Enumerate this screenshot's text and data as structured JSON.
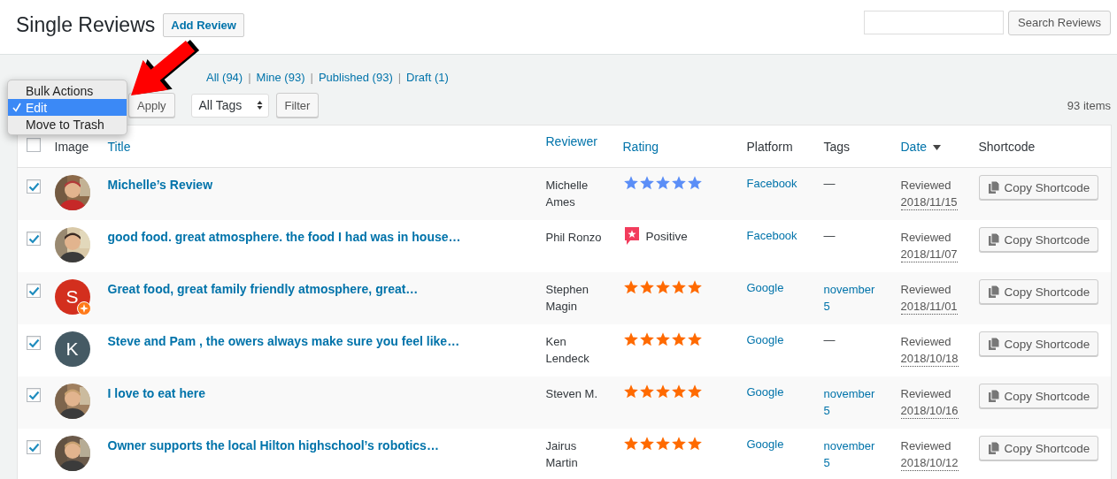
{
  "header": {
    "title": "Single Reviews",
    "add_button": "Add Review",
    "search_button": "Search Reviews"
  },
  "filters": [
    {
      "label": "All (94)",
      "selected": false
    },
    {
      "separator": "|",
      "label": "Mine (93)",
      "selected": false
    },
    {
      "separator": "|",
      "label": "Published (93)",
      "selected": false
    },
    {
      "separator": "|",
      "label": "Draft (1)",
      "selected": false
    }
  ],
  "bulk_menu": [
    {
      "label": "Bulk Actions",
      "selected": false
    },
    {
      "label": "Edit",
      "selected": true
    },
    {
      "label": "Move to Trash",
      "selected": false
    }
  ],
  "toolbar": {
    "apply": "Apply",
    "tags_select": "All Tags",
    "filter": "Filter",
    "count": "93 items"
  },
  "table": {
    "select_all": {
      "checked": false
    },
    "columns": [
      {
        "label": "Image",
        "link": false
      },
      {
        "label": "Title",
        "link": true
      },
      {
        "label": "Reviewer",
        "link": true
      },
      {
        "label": "Rating",
        "link": true
      },
      {
        "label": "Platform",
        "link": false
      },
      {
        "label": "Tags",
        "link": false
      },
      {
        "label": "Date",
        "link": true,
        "sorted": true
      },
      {
        "label": "Shortcode",
        "link": false
      }
    ],
    "rows": [
      {
        "checked": true,
        "title": "Michelle’s Review",
        "reviewer": "Michelle Ames",
        "rating": {
          "kind": "stars",
          "stars": 5,
          "color": "#5b8ef7"
        },
        "platform": "Facebook",
        "tags": {
          "kind": "none",
          "text": "—"
        },
        "date_label": "Reviewed",
        "date": "2018/11/15",
        "shortcode": "Copy Shortcode"
      },
      {
        "checked": true,
        "title": "good food. great atmosphere. the food I had was in house…",
        "reviewer": "Phil Ronzo",
        "rating": {
          "kind": "recommend",
          "label": "Positive"
        },
        "platform": "Facebook",
        "tags": {
          "kind": "none",
          "text": "—"
        },
        "date_label": "Reviewed",
        "date": "2018/11/07",
        "shortcode": "Copy Shortcode"
      },
      {
        "checked": true,
        "avatar": {
          "kind": "letter",
          "letter": "S",
          "color": "#d32f1e",
          "badge": true
        },
        "title": "Great food, great family friendly atmosphere, great…",
        "reviewer": "Stephen Magin",
        "rating": {
          "kind": "stars",
          "stars": 5,
          "color": "#ff6a00"
        },
        "platform": "Google",
        "tags": {
          "kind": "link",
          "text": "november 5"
        },
        "date_label": "Reviewed",
        "date": "2018/11/01",
        "shortcode": "Copy Shortcode"
      },
      {
        "checked": true,
        "avatar": {
          "kind": "letter",
          "letter": "K",
          "color": "#455a64"
        },
        "title": "Steve and Pam , the owers always make sure you feel like…",
        "reviewer": "Ken Lendeck",
        "rating": {
          "kind": "stars",
          "stars": 5,
          "color": "#ff6a00"
        },
        "platform": "Google",
        "tags": {
          "kind": "none",
          "text": "—"
        },
        "date_label": "Reviewed",
        "date": "2018/10/18",
        "shortcode": "Copy Shortcode"
      },
      {
        "checked": true,
        "title": "I love to eat here",
        "reviewer": "Steven M.",
        "rating": {
          "kind": "stars",
          "stars": 5,
          "color": "#ff6a00"
        },
        "platform": "Google",
        "tags": {
          "kind": "link",
          "text": "november 5"
        },
        "date_label": "Reviewed",
        "date": "2018/10/16",
        "shortcode": "Copy Shortcode"
      },
      {
        "checked": true,
        "title": "Owner supports the local Hilton highschool’s robotics…",
        "reviewer": "Jairus Martin",
        "rating": {
          "kind": "stars",
          "stars": 5,
          "color": "#ff6a00"
        },
        "platform": "Google",
        "tags": {
          "kind": "link",
          "text": "november 5"
        },
        "date_label": "Reviewed",
        "date": "2018/10/12",
        "shortcode": "Copy Shortcode"
      }
    ]
  }
}
